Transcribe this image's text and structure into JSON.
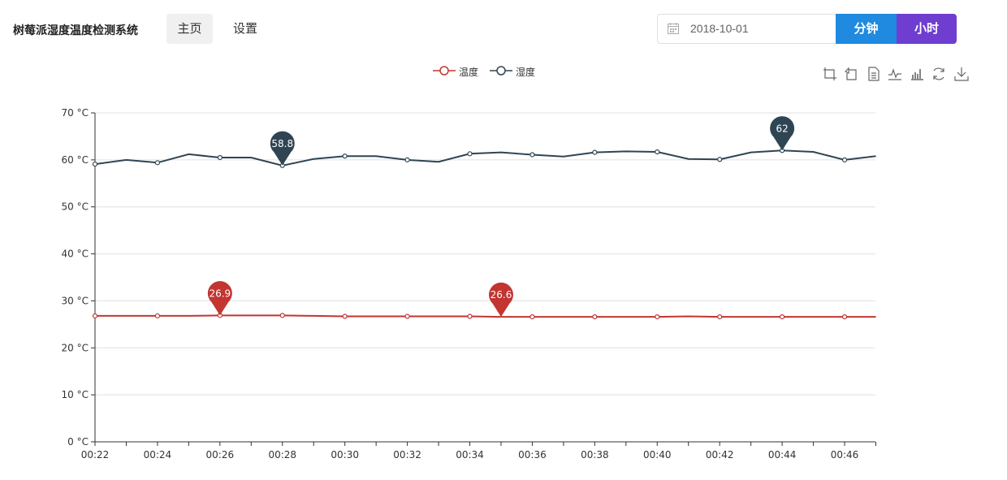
{
  "header": {
    "brand": "树莓派湿度温度检测系统",
    "nav": {
      "home": "主页",
      "settings": "设置"
    },
    "date_value": "2018-10-01",
    "btn_minute": "分钟",
    "btn_hour": "小时"
  },
  "colors": {
    "temperature": "#c23531",
    "humidity": "#2f4554",
    "minute_button": "#1f8ae0",
    "hour_button": "#6f3dcf"
  },
  "toolbox_icons": [
    "zoom-icon",
    "zoom-reset-icon",
    "data-view-icon",
    "line-chart-icon",
    "bar-chart-icon",
    "restore-icon",
    "save-image-icon"
  ],
  "chart_data": {
    "type": "line",
    "x": [
      "00:22",
      "00:23",
      "00:24",
      "00:25",
      "00:26",
      "00:27",
      "00:28",
      "00:29",
      "00:30",
      "00:31",
      "00:32",
      "00:33",
      "00:34",
      "00:35",
      "00:36",
      "00:37",
      "00:38",
      "00:39",
      "00:40",
      "00:41",
      "00:42",
      "00:43",
      "00:44",
      "00:45",
      "00:46",
      "00:47"
    ],
    "x_tick_labels": [
      "00:22",
      "00:24",
      "00:26",
      "00:28",
      "00:30",
      "00:32",
      "00:34",
      "00:36",
      "00:38",
      "00:40",
      "00:42",
      "00:44",
      "00:46"
    ],
    "y_tick_labels": [
      "0 °C",
      "10 °C",
      "20 °C",
      "30 °C",
      "40 °C",
      "50 °C",
      "60 °C",
      "70 °C"
    ],
    "ylim": [
      0,
      70
    ],
    "grid": true,
    "legend_position": "top-center",
    "series": [
      {
        "name": "温度",
        "color_key": "temperature",
        "values": [
          26.8,
          26.8,
          26.8,
          26.8,
          26.9,
          26.9,
          26.9,
          26.8,
          26.7,
          26.7,
          26.7,
          26.7,
          26.7,
          26.6,
          26.6,
          26.6,
          26.6,
          26.6,
          26.6,
          26.7,
          26.6,
          26.6,
          26.6,
          26.6,
          26.6,
          26.6
        ],
        "markers": [
          {
            "label": "26.9",
            "index": 4
          },
          {
            "label": "26.6",
            "index": 13
          }
        ]
      },
      {
        "name": "湿度",
        "color_key": "humidity",
        "values": [
          59.1,
          60.0,
          59.4,
          61.2,
          60.5,
          60.5,
          58.8,
          60.2,
          60.8,
          60.8,
          60.0,
          59.6,
          61.3,
          61.6,
          61.1,
          60.7,
          61.6,
          61.8,
          61.7,
          60.2,
          60.1,
          61.6,
          62.0,
          61.7,
          60.0,
          60.8
        ],
        "markers": [
          {
            "label": "58.8",
            "index": 6
          },
          {
            "label": "62",
            "index": 22
          }
        ]
      }
    ]
  }
}
